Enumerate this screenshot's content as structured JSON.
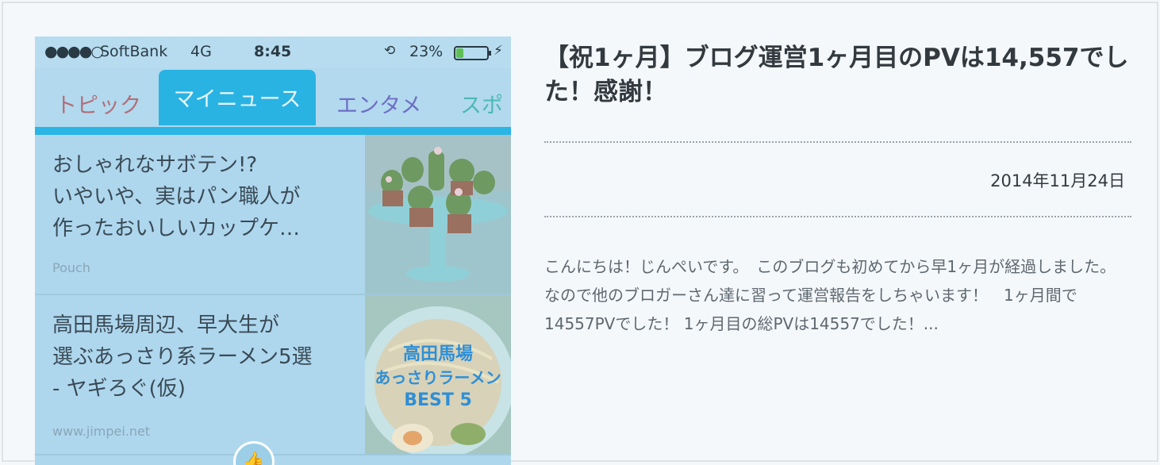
{
  "thumbnail": {
    "statusbar": {
      "signal": "●●●●○",
      "carrier": "SoftBank",
      "network": "4G",
      "time": "8:45",
      "lock_icon": "rotation-lock-icon",
      "battery": "23%",
      "battery_level": 0.23,
      "battery_fill_color": "#5fbf55"
    },
    "tabs": [
      "トピック",
      "マイニュース",
      "エンタメ",
      "スポー"
    ],
    "accent": "#29b3e3",
    "feed": [
      {
        "lines": [
          "おしゃれなサボテン!?",
          "いやいや、実はパン職人が",
          "作ったおいしいカップケ…"
        ],
        "source": "Pouch",
        "image": "cactus-cupcakes-image"
      },
      {
        "lines": [
          "高田馬場周辺、早大生が",
          "選ぶあっさり系ラーメン5選",
          "- ヤギろぐ(仮)"
        ],
        "source": "www.jimpei.net",
        "image": "ramen-image",
        "image_text": [
          "高田馬場",
          "あっさりラーメン",
          "BEST 5"
        ]
      }
    ],
    "floating_icon": "thumbs-up-icon",
    "floating_glyph": "👍"
  },
  "post": {
    "title": "【祝1ヶ月】ブログ運営1ヶ月目のPVは14,557でした！感謝！",
    "date": "2014年11月24日",
    "excerpt": "こんにちは！じんぺいです。　このブログも初めてから早1ヶ月が経過しました。 なので他のブロガーさん達に習って運営報告をしちゃいます！　1ヶ月間で14557PVでした！ 1ヶ月目の総PVは14557でした！..."
  }
}
